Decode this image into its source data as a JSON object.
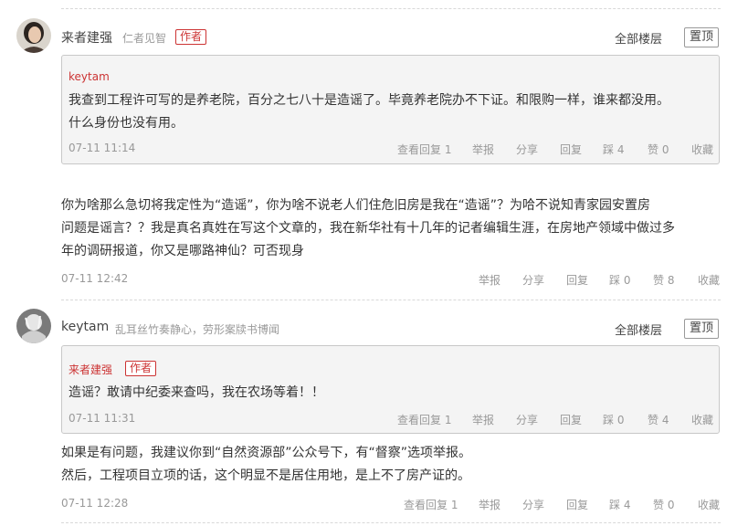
{
  "comment1": {
    "author": "来者建强",
    "signature": "仁者见智",
    "badge": "作者",
    "floors": "全部楼层",
    "pin": "置顶",
    "quote": {
      "author": "keytam",
      "text_lines": [
        "我查到工程许可写的是养老院，百分之七八十是造谣了。毕竟养老院办不下证。和限购一样，谁来都没用。",
        "什么身份也没有用。"
      ],
      "time": "07-11 11:14",
      "actions": [
        "查看回复 1",
        "举报",
        "分享",
        "回复",
        "踩 4",
        "赞 0",
        "收藏"
      ]
    },
    "text_lines": [
      "你为啥那么急切将我定性为“造谣”，你为啥不说老人们住危旧房是我在“造谣”？为哈不说知青家园安置房",
      "问题是谣言？？我是真名真姓在写这个文章的，我在新华社有十几年的记者编辑生涯，在房地产领域中做过多",
      "年的调研报道，你又是哪路神仙？可否现身"
    ],
    "time": "07-11 12:42",
    "actions": [
      "举报",
      "分享",
      "回复",
      "踩 0",
      "赞 8",
      "收藏"
    ]
  },
  "comment2": {
    "author": "keytam",
    "signature": "乱耳丝竹奏静心，劳形案牍书博闻",
    "floors": "全部楼层",
    "pin": "置顶",
    "quote": {
      "author": "来者建强",
      "badge": "作者",
      "text": "造谣？敢请中纪委来查吗，我在农场等着！！",
      "time": "07-11 11:31",
      "actions": [
        "查看回复 1",
        "举报",
        "分享",
        "回复",
        "踩 0",
        "赞 4",
        "收藏"
      ]
    },
    "text_lines": [
      "如果是有问题，我建议你到“自然资源部”公众号下，有“督察”选项举报。",
      "然后，工程项目立项的话，这个明显不是居住用地，是上不了房产证的。"
    ],
    "time": "07-11 12:28",
    "actions": [
      "查看回复 1",
      "举报",
      "分享",
      "回复",
      "踩 4",
      "赞 0",
      "收藏"
    ]
  }
}
